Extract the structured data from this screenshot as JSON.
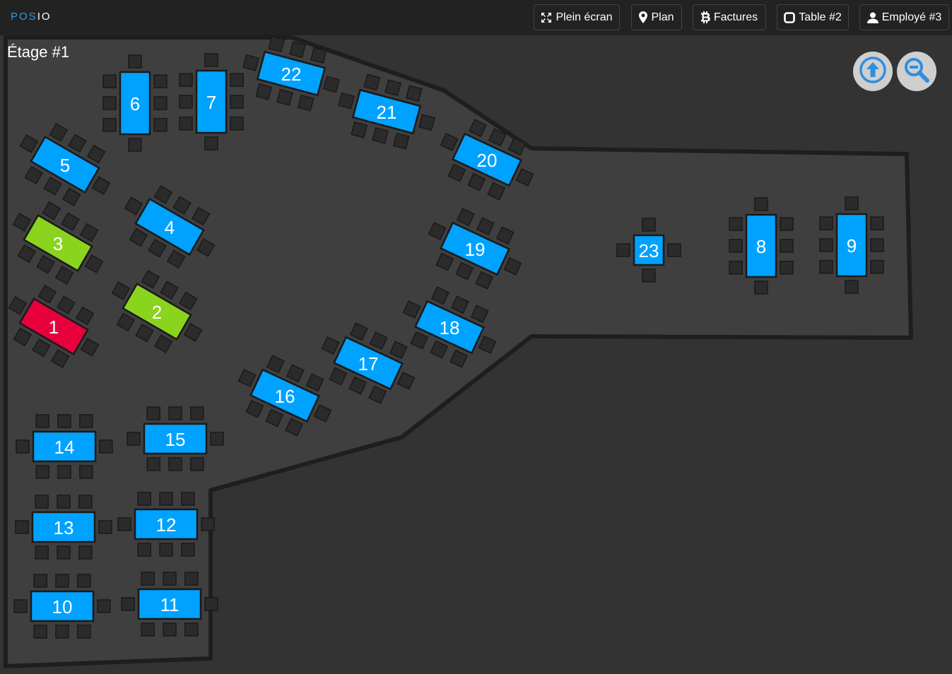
{
  "header": {
    "brand_part1": "POS",
    "brand_part2": "IO",
    "buttons": [
      {
        "label": "Plein écran",
        "icon": "fullscreen-icon"
      },
      {
        "label": "Plan",
        "icon": "map-marker-icon"
      },
      {
        "label": "Factures",
        "icon": "bitcoin-icon"
      },
      {
        "label": "Table #2",
        "icon": "square-icon"
      },
      {
        "label": "Employé #3",
        "icon": "user-icon"
      }
    ]
  },
  "floor": {
    "title": "Étage #1",
    "controls": [
      {
        "name": "level-up-button",
        "icon": "arrow-up-circle-icon"
      },
      {
        "name": "zoom-out-button",
        "icon": "zoom-out-icon"
      }
    ]
  },
  "colors": {
    "free": "#00a2ff",
    "occupied": "#8ad41e",
    "alert": "#e8003d",
    "chair": "#2b2b2b",
    "floor": "#3f3f3f",
    "wall": "#1e1e1e"
  },
  "tables": [
    {
      "number": "1",
      "status": "alert"
    },
    {
      "number": "2",
      "status": "occupied"
    },
    {
      "number": "3",
      "status": "occupied"
    },
    {
      "number": "4",
      "status": "free"
    },
    {
      "number": "5",
      "status": "free"
    },
    {
      "number": "6",
      "status": "free"
    },
    {
      "number": "7",
      "status": "free"
    },
    {
      "number": "8",
      "status": "free"
    },
    {
      "number": "9",
      "status": "free"
    },
    {
      "number": "10",
      "status": "free"
    },
    {
      "number": "11",
      "status": "free"
    },
    {
      "number": "12",
      "status": "free"
    },
    {
      "number": "13",
      "status": "free"
    },
    {
      "number": "14",
      "status": "free"
    },
    {
      "number": "15",
      "status": "free"
    },
    {
      "number": "16",
      "status": "free"
    },
    {
      "number": "17",
      "status": "free"
    },
    {
      "number": "18",
      "status": "free"
    },
    {
      "number": "19",
      "status": "free"
    },
    {
      "number": "20",
      "status": "free"
    },
    {
      "number": "21",
      "status": "free"
    },
    {
      "number": "22",
      "status": "free"
    },
    {
      "number": "23",
      "status": "free"
    }
  ]
}
